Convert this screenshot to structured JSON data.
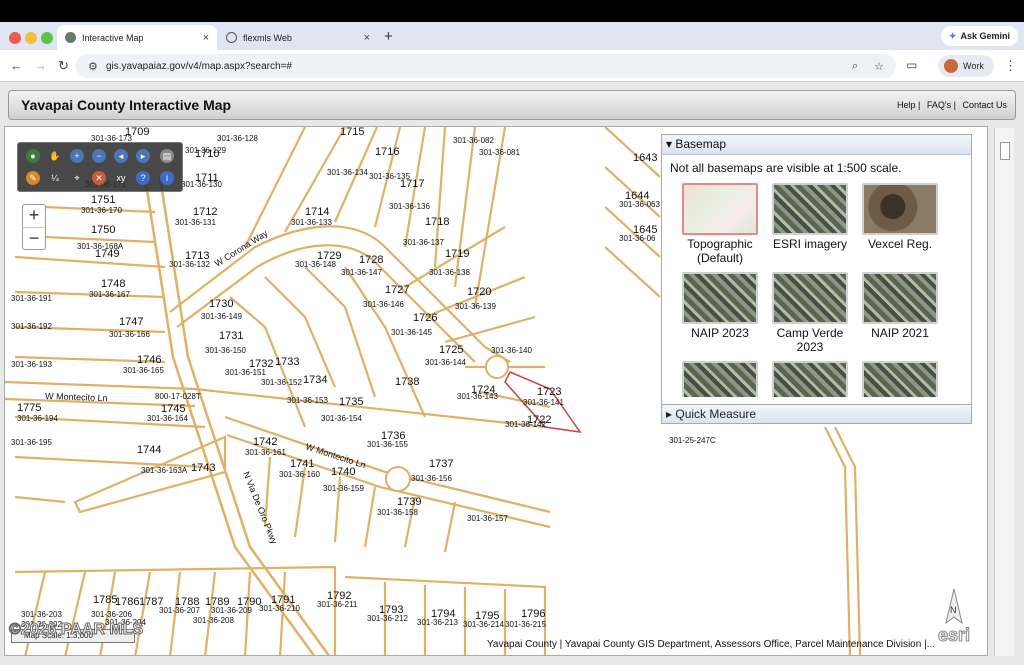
{
  "browser": {
    "tabs": [
      {
        "label": "Interactive Map",
        "close": "×"
      },
      {
        "label": "flexmls Web",
        "close": "×"
      }
    ],
    "new_tab": "+",
    "gemini_label": "Ask Gemini",
    "url": "gis.yavapaiaz.gov/v4/map.aspx?search=#",
    "profile_label": "Work",
    "nav": {
      "back": "←",
      "forward": "→",
      "reload": "↻",
      "menu": "⋮"
    }
  },
  "header": {
    "title": "Yavapai County Interactive Map",
    "links": [
      "Help",
      "FAQ's",
      "Contact Us"
    ]
  },
  "zoom": {
    "plus": "+",
    "minus": "−"
  },
  "basemap": {
    "title": "Basemap",
    "note": "Not all basemaps are visible at 1:500 scale.",
    "options": [
      {
        "label": "Topographic (Default)",
        "style": "topo"
      },
      {
        "label": "ESRI imagery",
        "style": "imagery"
      },
      {
        "label": "Vexcel Reg.",
        "style": "vexcel"
      },
      {
        "label": "NAIP 2023",
        "style": "imagery"
      },
      {
        "label": "Camp Verde 2023",
        "style": "imagery"
      },
      {
        "label": "NAIP 2021",
        "style": "imagery"
      }
    ]
  },
  "quick_measure": "Quick Measure",
  "attribution": "Yavapai County | Yavapai County GIS Department, Assessors Office, Parcel Maintenance Division |...",
  "scale_label": "Map Scale: 1:3,000",
  "watermark": "©2026 PAAR MLS",
  "esri_logo": "esri",
  "north_label": "N",
  "map": {
    "streets": [
      "W Corona Way",
      "W Montecito Ln",
      "W Montecito Ln",
      "N Via De Oro Pkwy"
    ],
    "lots": [
      "1715",
      "1716",
      "1717",
      "1718",
      "1719",
      "1720",
      "1714",
      "1729",
      "1728",
      "1727",
      "1726",
      "1725",
      "1724",
      "1723",
      "1722",
      "1730",
      "1731",
      "1732",
      "1733",
      "1734",
      "1735",
      "1736",
      "1737",
      "1738",
      "1739",
      "1740",
      "1741",
      "1742",
      "1743",
      "1744",
      "1745",
      "1746",
      "1747",
      "1748",
      "1749",
      "1750",
      "1751",
      "1712",
      "1713",
      "1711",
      "1710",
      "1709",
      "1775",
      "1792",
      "1793",
      "1794",
      "1795",
      "1796",
      "1643",
      "1644",
      "1645",
      "1791",
      "1790",
      "1789",
      "1788",
      "1787",
      "1786",
      "1785"
    ],
    "parcels": [
      "301-36-173",
      "301-36-128",
      "301-36-129",
      "301-36-130",
      "301-36-171",
      "301-36-170",
      "301-36-131",
      "301-36-168A",
      "301-36-132",
      "301-36-167",
      "301-36-191",
      "301-36-192",
      "301-36-166",
      "301-36-193",
      "301-36-165",
      "301-36-194",
      "301-36-164",
      "301-36-195",
      "301-36-163A",
      "301-36-134",
      "301-36-135",
      "301-36-136",
      "301-36-133",
      "301-36-137",
      "301-36-148",
      "301-36-147",
      "301-36-138",
      "301-36-146",
      "301-36-139",
      "301-36-149",
      "301-36-145",
      "301-36-150",
      "301-36-144",
      "301-36-151",
      "301-36-152",
      "301-36-140",
      "301-36-153",
      "301-36-143",
      "301-36-141",
      "301-36-154",
      "301-36-142",
      "301-36-155",
      "301-36-161",
      "301-36-156",
      "301-36-160",
      "301-36-159",
      "301-36-158",
      "301-36-157",
      "301-36-082",
      "301-36-081",
      "301-36-063",
      "301-36-06",
      "301-25-247C",
      "301-36-211",
      "301-36-212",
      "301-36-213",
      "301-36-214",
      "301-36-215",
      "301-36-210",
      "301-36-209",
      "301-36-208",
      "301-36-207",
      "301-36-206",
      "301-36-203",
      "301-36-202",
      "301-36-204",
      "800-17-028T"
    ]
  }
}
